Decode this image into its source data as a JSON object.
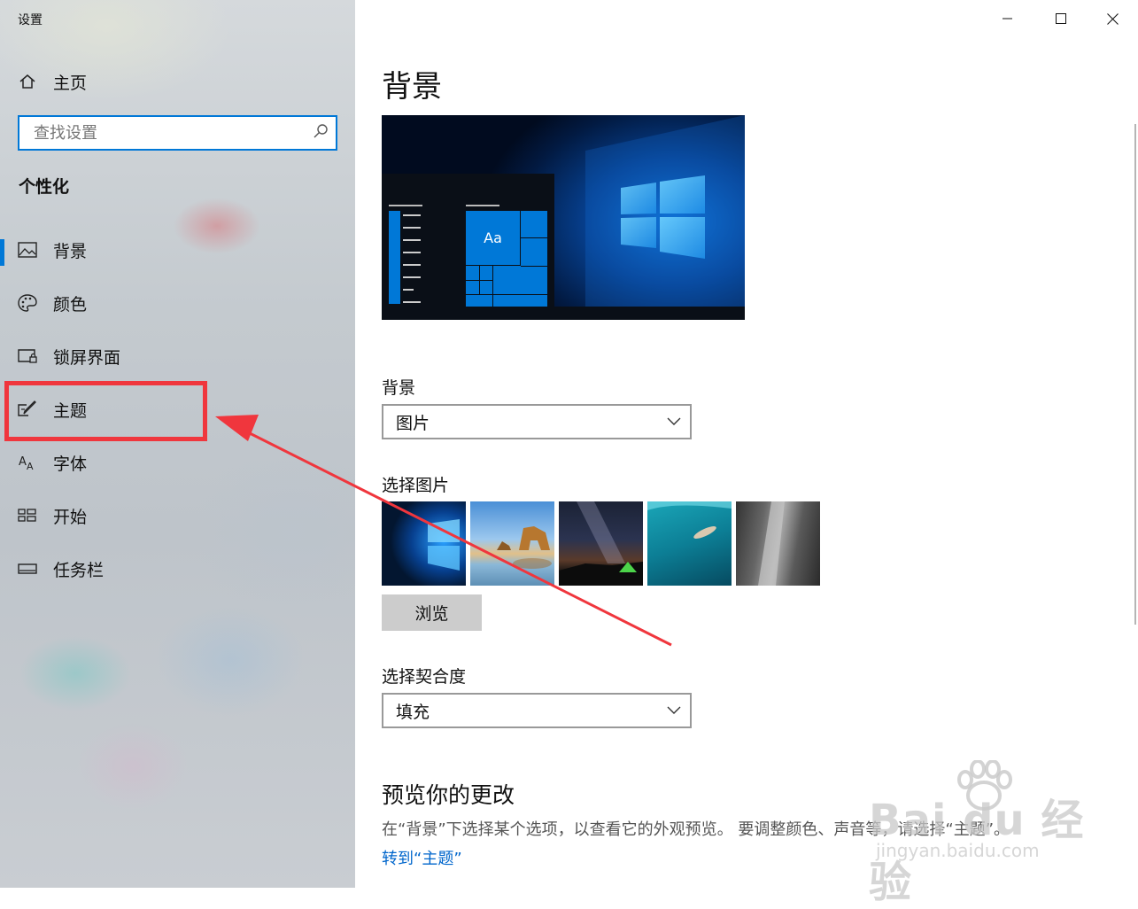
{
  "window": {
    "title": "设置",
    "controls": {
      "minimize": "minimize",
      "maximize": "maximize",
      "close": "close"
    }
  },
  "sidebar": {
    "home_label": "主页",
    "search_placeholder": "查找设置",
    "section_title": "个性化",
    "items": [
      {
        "label": "背景",
        "icon": "picture-icon",
        "active": true
      },
      {
        "label": "颜色",
        "icon": "palette-icon",
        "active": false
      },
      {
        "label": "锁屏界面",
        "icon": "lock-screen-icon",
        "active": false
      },
      {
        "label": "主题",
        "icon": "theme-icon",
        "active": false,
        "highlighted": true
      },
      {
        "label": "字体",
        "icon": "font-icon",
        "active": false
      },
      {
        "label": "开始",
        "icon": "start-icon",
        "active": false
      },
      {
        "label": "任务栏",
        "icon": "taskbar-icon",
        "active": false
      }
    ]
  },
  "main": {
    "title": "背景",
    "preview": {
      "sample_text": "Aa"
    },
    "background": {
      "label": "背景",
      "value": "图片"
    },
    "choose_picture": {
      "label": "选择图片",
      "thumbnails": [
        "windows-hero",
        "rock-arch-beach",
        "night-sky-tent",
        "underwater-swimmer",
        "rock-cliff"
      ]
    },
    "browse_label": "浏览",
    "fit": {
      "label": "选择契合度",
      "value": "填充"
    },
    "preview_section": {
      "title": "预览你的更改",
      "description": "在“背景”下选择某个选项，以查看它的外观预览。 要调整颜色、声音等，请选择“主题”。",
      "link": "转到“主题”"
    }
  },
  "watermark": {
    "text": "Bai du 经验",
    "sub": "jingyan.baidu.com"
  },
  "colors": {
    "accent": "#0078d7",
    "annotation_red": "#f0363d",
    "link": "#0066cc"
  }
}
